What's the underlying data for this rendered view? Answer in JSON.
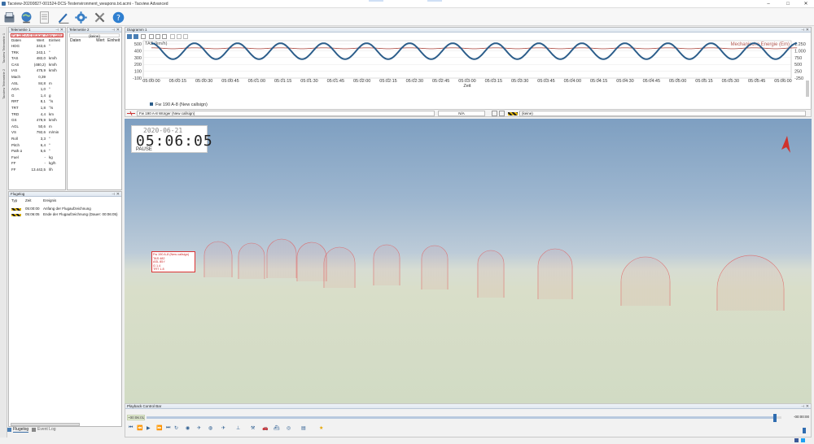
{
  "window": {
    "title": "Tacview-20200827-001524-DCS-Testenvironment_weapons.txt.acmi - Tacview Advanced",
    "min": "–",
    "max": "□",
    "close": "✕"
  },
  "toolbar": {
    "icons": [
      "open-file-icon",
      "globe-icon",
      "document-icon",
      "pencil-icon",
      "settings-gear-icon",
      "tools-icon",
      "help-icon"
    ]
  },
  "sidetabs": [
    "Tacview Telemetrie 1",
    "Tacview Telemetrie 2"
  ],
  "telemetry1": {
    "title": "Telemetrie 1",
    "object": "Fw 190 A-8 Würger (New callsi...",
    "headers": [
      "Daten",
      "Wert",
      "Einheit"
    ],
    "rows": [
      [
        "HDG",
        "243,6",
        "°"
      ],
      [
        "TRK",
        "243,1",
        "°"
      ],
      [
        "TAS",
        "482,0",
        "km/h"
      ],
      [
        "CAS",
        "(480,2)",
        "km/h"
      ],
      [
        "IAS",
        "475,9",
        "km/h"
      ],
      [
        "Mach",
        "0,39",
        ""
      ],
      [
        "ASL",
        "84,8",
        "m"
      ],
      [
        "AOA",
        "1,0",
        "°"
      ],
      [
        "G",
        "1,4",
        "g"
      ],
      [
        "RRT",
        "8,1",
        "°/s"
      ],
      [
        "TRT",
        "1,8",
        "°/s"
      ],
      [
        "TRD",
        "4,4",
        "km"
      ],
      [
        "GS",
        "479,9",
        "km/h"
      ],
      [
        "AGL",
        "50,6",
        "m"
      ],
      [
        "VS",
        "792,6",
        "m/min"
      ],
      [
        "Roll",
        "3,3",
        "°"
      ],
      [
        "Pitch",
        "6,4",
        "°"
      ],
      [
        "Path α",
        "5,6",
        "°"
      ],
      [
        "Fuel",
        "-",
        "kg"
      ],
      [
        "FF",
        "-",
        "kg/h"
      ],
      [
        "FF",
        "13.442,5",
        "l/h"
      ]
    ]
  },
  "telemetry2": {
    "title": "Telemetrie 2",
    "object": "(keine)",
    "headers": [
      "Daten",
      "Wert",
      "Einheit"
    ]
  },
  "flightlog": {
    "title": "Flugelog",
    "headers": [
      "Typ",
      "Zeit",
      "Ereignis"
    ],
    "rows": [
      [
        "05:00:00",
        "Anfang der Flugaufzeichnung"
      ],
      [
        "05:06:05",
        "Ende der Flugaufzeichnung (Dauer: 00:06:05)"
      ]
    ]
  },
  "bottomtabs": [
    "Flugelog",
    "Event Log"
  ],
  "diagram": {
    "title": "Diagramm 1",
    "left_axis_label": "TAS (km/h)",
    "right_axis_label": "Mechanische Energie (Em)",
    "x_axis_label": "Zeit",
    "legend": "Fw 190 A-8 (New callsign)",
    "series_colors": {
      "tas": "#2b5d8a",
      "energy": "#b45a52"
    }
  },
  "chart_data": {
    "type": "line",
    "xlabel": "Zeit",
    "ylabel": "TAS (km/h)",
    "y2label": "Mechanische Energie (Em)",
    "ylim": [
      -100,
      500
    ],
    "y2lim": [
      -250,
      1250
    ],
    "ytick_labels": [
      "500",
      "400",
      "300",
      "200",
      "100",
      "-100"
    ],
    "y2tick_labels": [
      "1.250",
      "1.000",
      "750",
      "500",
      "250",
      "-250"
    ],
    "x_tick_labels": [
      "05:00:00",
      "05:00:15",
      "05:00:30",
      "05:00:45",
      "05:01:00",
      "05:01:15",
      "05:01:30",
      "05:01:45",
      "05:02:00",
      "05:02:15",
      "05:02:30",
      "05:02:45",
      "05:03:00",
      "05:03:15",
      "05:03:30",
      "05:03:45",
      "05:04:00",
      "05:04:15",
      "05:04:30",
      "05:04:45",
      "05:05:00",
      "05:05:15",
      "05:05:30",
      "05:05:45",
      "05:06:00"
    ],
    "series": [
      {
        "name": "Fw 190 A-8 (New callsign)",
        "x_start_s": 0,
        "x_end_s": 368,
        "cycles": 15,
        "min": 232,
        "max": 512
      },
      {
        "name": "Mechanische Energie (Em)",
        "x_start_s": 0,
        "x_end_s": 368,
        "cycles": 15,
        "min": 1040,
        "max": 1080
      }
    ]
  },
  "vehicle_bar": {
    "primary": "Fw 190 A-8 Würger (New callsign)",
    "secondary": "N/A",
    "tertiary": "(keine)"
  },
  "overlay": {
    "date": "2020-06-21",
    "time": "05:06:05",
    "status": "PAUSE"
  },
  "label_box": [
    "Fw 190 A-8 (New callsign)",
    "TAS 482",
    "ASL 85 f",
    "G 1.4",
    "TRT 1.8"
  ],
  "playback": {
    "title": "Playback Control Bar",
    "start": "+00:06:01",
    "end": "-00:00:00",
    "progress": 0.99
  }
}
